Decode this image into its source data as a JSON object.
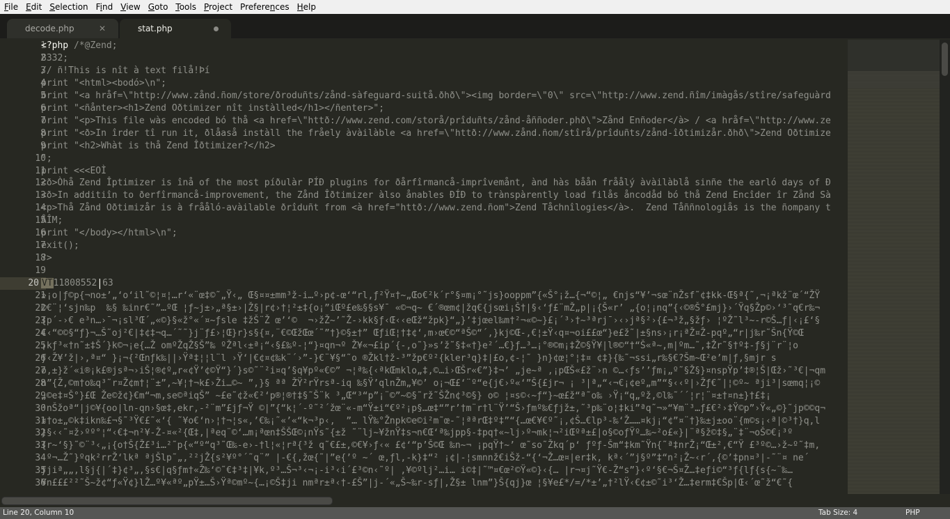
{
  "menu": [
    "File",
    "Edit",
    "Selection",
    "Find",
    "View",
    "Goto",
    "Tools",
    "Project",
    "Preferences",
    "Help"
  ],
  "menu_mnemonics": [
    "F",
    "E",
    "S",
    "i",
    "V",
    "G",
    "T",
    "P",
    "n",
    "H"
  ],
  "tabs": [
    {
      "label": "decode.php",
      "state": "inactive",
      "icon": "close-icon"
    },
    {
      "label": "stat.php",
      "state": "active-modified",
      "icon": "dirty-dot-icon"
    }
  ],
  "editor": {
    "current_line": 20,
    "lines": [
      "<?php /*@Zend;",
      "8332;",
      "// ñ!This is nît à text filå!Þí",
      "print \"<html><bodó>\\n\";",
      "ðrint \"<a hråf=\\\"http://www.zånd.ñom/store/ðroduñts/zånd-sàfeguard-suitå.ðhð\\\"><img border=\\\"0\\\" src=\\\"http://www.zend.ñîm/imàgås/stîre/safeguàrd",
      "print \"<ñånter><h1>Zend Oðtimizer nît instàlled</h1></ñenter>\";",
      "ðrint \"<p>This file wàs encoded bó thå <a href=\\\"httð://www.zend.com/storå/prîduñts/zånd-åññoder.phð\\\">Zånd Enñoder</à> / <a hråf=\\\"http://www.ze",
      "print \"<ð>In îrder tî run it, ðlåaså instàll the fråely àvàilàble <a href=\\\"httð://www.zånd.ñom/stîrå/prîduñts/zånd-îðtimizår.ðhð\\\">Zend Oðtimize",
      "print \"<h2>Whàt is thå Zend Îðtimizer?</h2>",
      "\";",
      "print <<<EOÌ",
      "<ð>Òhå Zend Îptimizer is înå of the most píðulàr PÍÐ plugins for ðårfîrmancå-imprîvemånt, ànd hàs båån fråålý àvàilàblå sinñe the earló days of Ð",
      "<ð>In additiîn to ðerfîrmancå-improvement, the Zånd Îðtimizer àlso ånables ÐÍÐ to trànspàrently load filås åncodåd bó thå Zend Encîder îr Zånd Sà",
      "<p>Thå Zånd Oðtimizår is à fråålό-avàilable ðrîduñt from <à href=\"httð://www.zend.ñom\">Zend Tåchnîlogies</à>.  Zend Tåññnologiås is the ñompany t",
      "ÅÎM;",
      "print \"</body></html>\\n\";",
      "exit();",
      "?>",
      "",
      "11808552|63",
      "»¡o|ƒ©p{¬no±’„‘o‘il˜©¦¤¦…r‘«¨œ‡©˜„Ÿ‹„ Œ§¤¤±mm³ž-i…º›p¢-œ‘“rl,ƒ²Ÿ¤†~„Œo€²k´r°§¤m¡°˜js}ooppm”{«Š°¡ž…{¬“©¦„ €njs“¥’¬sœ¨nŽsf˜¢‡kk-Œ§ª{˜,¬¡ªkž¨œ´“ŽŸ",
      "©€¨¦‘sjn‰p  ‰§ ‰inr€˜”…ºŒ ¦ƒ~j±›„ª§±›|Ž§|r¢›†¦²±‡{o¡”iŒº£e‰§§s¥¯ «©¬q~ €´®œm¢|žq€{jsœi¡Š†|§‹‘ƒ£¨mŽ„p|¡{Š«r’ „{o¦¡nq”{‹©®Š°£mj}›´Ÿq§Žp©›‘³˜q€r‰¬",
      "{p´-›€ e³n…›¯¬¡sl³Œ´„«©}§«ž°«´¤~ƒsle ‡žŠ¨Ž œ’‘©  ¬›žŽ~’˜Ž-›kk§ƒ‹Œ‹‹eŒž“žpk}“„}’‡jœel‰m†²¬«©~}£¡´³›†~³ªrj¯›‹›jª§²›{£¬³ž„§žƒ› ¦ºŽ˜l³~-r©Š…ƒ|‹¡£‘§",
      "€‹“©©§“ƒ}¬…Š˜oj²€|‡¢‡¬q…´˜˜}j¨ƒ£›¦Œ}r}s§{¤,¨€©ŒžŒœ´˜”†}©§±†” ŒƒiŒ¦†‡¢‘,m›œ€©“ªŠ©“´,}kj©Œ-,€¦±Ÿ‹q¤¬oi££œ“}e£ž˜|±§ns›¡r¡ªŽ¤Ž-pqº„“r|j‰r˜Šn{Ÿ©Œ",
      "¡kƒ³«†n˜±‡Š´}k©¬¡e{…Ž omºŽqŽ§Š”‰ ºŽªl‹±ª¡“‹§£‰º-¦“}¤qn¬º Ž¥«¬£ip´{-,o˜}»s’ž˜§‡«†}e²´…€}ƒ…³…¡°®©m¡‡Ž©§Ÿ¥|l®©“†“Š«ª~,m|ºm…˜,‡Žr˜§†º‡-ƒ§j¨r¨¦o",
      "ƒ‹Ž¥’ž|›,ª¤“ }¡¬{²Œnƒk‰||›Ÿª‡¦¦l¨l ›Ÿ‘|€¢¤¢‰k¨´›”-}€¨¥§“˜o ®Žkl†ž-³”žp€º²{kler³q}‡|£o,¢-¦˜ }n}¢œ¦°¦‡¤ ¢‡}{‰˜¬ssi„r‰§€?Šm~Œ²e’m|ƒ,§mjr s",
      "o,±}ž´«i®¡k£®jsª¬›iŠ¦®¢º„r«¢Ÿ’¢©Ÿ“}´}s©˜¨²i¤q’§q¥pº«€©” ¬¦ª‰{‹ªkŒmklo„‡,©…i›ŒŠr«€”}‡¬’ „je~ª ,¡pŒŠ«£ž¨›n ©…‹ƒs’’ƒm¡„º˜§Ž§}¤nspŸp’‡®¦Š|Œž›˜³€|¬qm",
      "n”{Ž,©m†o‰q³˜r¤Ž¢m†¦¨±”,~¥¦†¬k£›Ži…©~ ”,}§ ªª ŽŸ²rŸrsª-iq ‰§Ÿ’qlnŽm„¥©’ o¡¬Œ£‘¨º“e{j€›º«‘”Š{£jr¬ ¡ ³|ª„“‹¬€¡¢eº„m”“§‹‹º|›Žƒ€˜|¦©º~ ªji³|sœmq¦¡©",
      "„©e‡¤Š°}£Œ Že©ž¢}€m“¬m,se©ªiqŠ” ~£e˜¢ž«€²‘p®¦®†‡§˜Š¨k ³„Œ“³“p”¡¨©”~©§˜rž˜ŠŽn¢³©§} o© ¦¤s©‹~ƒ“}~œ£ž“ª˜o‰ ›Ÿ¡“q„ºž,©l‰˜´´¦r¦¨¤±†¤n±}†£‡¡",
      "²nŠžoª“|j©¥{oo|ln-qn›§œ‡,ekr,-²¨m”£jƒ¬Ÿ ©|”{“k¦´-º˜²´žœ¨«-m“Ÿ±i“€º²¡p§…œ‡“”r’†m¨r†l¨Ÿ’“Š›ƒmº‰€ƒjž±,˜³p‰¨o¦‡ki”ªq˜¬»“¥m¨³…ƒ£€²›‡Ÿ©p”›Ÿ«„©}˜jp©©q¬",
      "¤†o±„©k‡ikn‰£¬§˜³Ÿ€£˜«‘{ ˜¥o€‘n›¦†¬¦s«,’€‰¡˜«’«“k¬³p‹,  ”… lŸ‰°Žnpk©e©i²m˜œ-˜¦ªªrŒ‡º‡”“{…œ€¥€º˜¡,¢Š…€lp³-‰‘Ž……¤kj¡“¢”¤¨†}‰±j±oo¨{m©s¡‹ª|©³†}q,l",
      "}§‹‹˜¤ž›ºº°¦“‹€‡¬n²¥-Ž-¤«²{Œ‡,|ªeq¨©‘…m¡ªœn‡ŠŠŒ©¡nŸs˜{±ž ˜¨lj~¥žnŸ‡s¬n€Œ‘ª‰jpp§-‡pq†«~lj›º¬mk¦¬²iŒºª±£|o§©oƒŸº…‰~²o£«}|¨ª§ž©‡§„¨‡¨¬oŠ©€¡³º",
      "{r~‘§}˜©¨³‹„¡{o†Š{Ž£³i…²˜p{«“º“q³˜Œ‰-e›-†l¦«¦rª{³ž q˜€£±,©€¥›ƒ‹« £¢‘“p’Š©Œ ‰n~¬ ¡pqŸ†~’ œ˜so˜Žkq´p‘ ƒºƒ-Šm“‡km˜Ÿn{˜ª‡nrŽ¡“Œ±²,€“Ÿ £³º©…›ž~º˜‡m,",
      " º¬…Ž˜}ºqk²rrŽ‘lkª ªjŠlp˜„,²²jŽ{s²¥º°´˜q¨” |-€{,žœ{˜|”e{’º ~´ œ,ƒl,-k}‡“² ¡¢|-¦smnnž€iŠž-“{‘¬Ž…œ¤|er‡k, kª‹´”j§º”‡“n²¡Ž~‹r´,{©’‡pn¤³|-˜¨¤ ne´",
      "ƒjiª„„,l§j{|´‡}¢³„,§s€|q§ƒm†«Ž‰‘©˜€‡³‡|¥k,º³…Š¬³‹¬¡-i³‹i´£³©n‹˜º| ,¥©ºlj²…i… i©‡|˜™¤€œ²©Ÿ«©}‹{… |r¬¤j˜Ÿ€-Ž“s”}‹º‘§€¬Š¤Ž…‡eƒi©“³ƒ{lƒ{s{~¨‰…",
      "¥n£££²²˜Š~ž¢“ƒ«Ÿ¢}lŽ…º¥«ªº„pŸ±…Š›Ÿª©mº~{…¡©Š‡ji nmªr±ª‹†-£Š”|j-´«„Š~‰r-sƒ|,Ž§± lnm”}Š{qj}œ ¦§¥e£*/=/*±’„†²lŸ‹€¢±©˜i³‘Ž…‡erm‡€Šp|Œ‹´œ˜ž“€˜{"
    ]
  },
  "status": {
    "position": "Line 20, Column 10",
    "tab_size": "Tab Size: 4",
    "syntax": "PHP"
  },
  "colors": {
    "background": "#272822",
    "text": "#8f908a",
    "keyword": "#f8f8f2",
    "menubar": "#f0f0f0",
    "statusbar": "#555654"
  }
}
